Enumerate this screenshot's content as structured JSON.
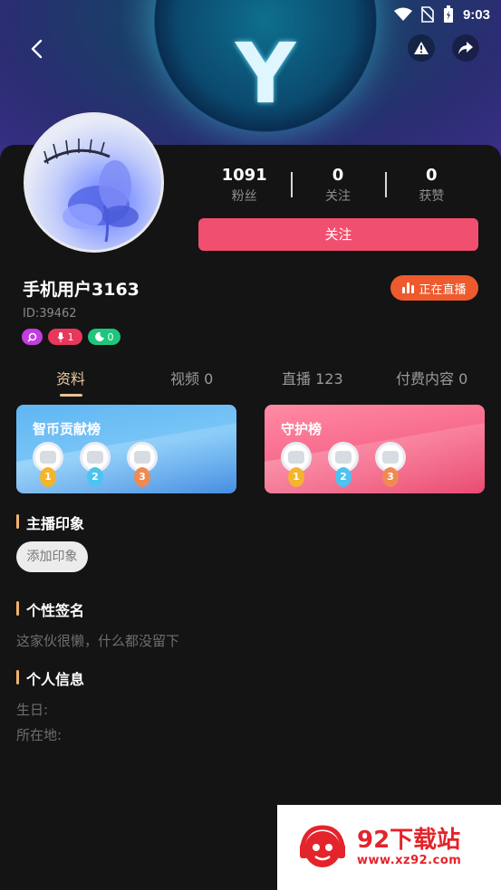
{
  "status_bar": {
    "time": "9:03"
  },
  "header": {
    "back_icon": "chevron-left-icon",
    "report_icon": "warning-icon",
    "share_icon": "share-icon"
  },
  "profile": {
    "stats": [
      {
        "value": "1091",
        "label": "粉丝"
      },
      {
        "value": "0",
        "label": "关注"
      },
      {
        "value": "0",
        "label": "获赞"
      }
    ],
    "follow_label": "关注",
    "username": "手机用户3163",
    "user_id": "ID:39462",
    "live_label": "正在直播",
    "badges": [
      {
        "icon": "search-icon",
        "value": ""
      },
      {
        "icon": "mic-icon",
        "value": "1"
      },
      {
        "icon": "moon-icon",
        "value": "0"
      }
    ]
  },
  "tabs": [
    "资料",
    "视频 0",
    "直播 123",
    "付费内容 0"
  ],
  "active_tab": 0,
  "rankings": [
    {
      "title": "智币贡献榜",
      "ranks": [
        "1",
        "2",
        "3"
      ]
    },
    {
      "title": "守护榜",
      "ranks": [
        "1",
        "2",
        "3"
      ]
    }
  ],
  "sections": {
    "impression_title": "主播印象",
    "add_impression": "添加印象",
    "signature_title": "个性签名",
    "signature_text": "这家伙很懒，什么都没留下",
    "info_title": "个人信息",
    "birthday_label": "生日:",
    "location_label": "所在地:"
  },
  "watermark": {
    "title": "92下载站",
    "url": "www.xz92.com"
  },
  "colors": {
    "accent_pink": "#f14f6f",
    "live_orange": "#ee5a2e",
    "tab_active": "#e7c9a0"
  }
}
